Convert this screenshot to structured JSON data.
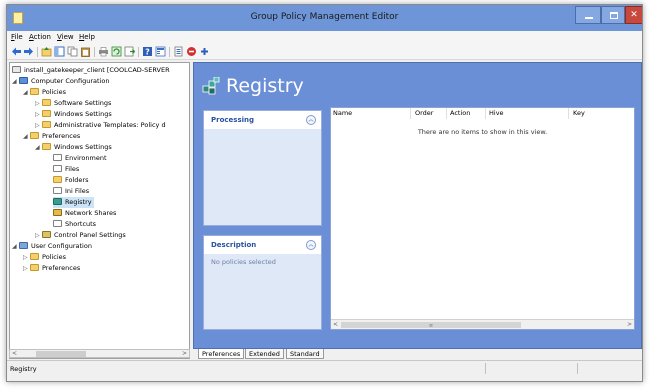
{
  "window": {
    "title": "Group Policy Management Editor"
  },
  "menu": {
    "items": [
      {
        "acc": "F",
        "rest": "ile"
      },
      {
        "acc": "A",
        "rest": "ction"
      },
      {
        "acc": "V",
        "rest": "iew"
      },
      {
        "acc": "H",
        "rest": "elp"
      }
    ]
  },
  "toolbar": {
    "icons": [
      "back-arrow-icon",
      "forward-arrow-icon",
      "up-folder-icon",
      "show-hide-tree-icon",
      "copy-icon",
      "paste-icon",
      "print-icon",
      "refresh-icon",
      "export-list-icon",
      "help-icon",
      "tree-view-icon",
      "properties-icon",
      "block-icon",
      "add-icon"
    ]
  },
  "tree": {
    "root": "install_gatekeeper_client [COOLCAD-SERVER",
    "computer_configuration": "Computer Configuration",
    "policies": "Policies",
    "software_settings": "Software Settings",
    "windows_settings": "Windows Settings",
    "admin_templates": "Administrative Templates: Policy d",
    "preferences": "Preferences",
    "pref_windows_settings": "Windows Settings",
    "environment": "Environment",
    "files": "Files",
    "folders": "Folders",
    "ini_files": "Ini Files",
    "registry": "Registry",
    "network_shares": "Network Shares",
    "shortcuts": "Shortcuts",
    "control_panel_settings": "Control Panel Settings",
    "user_configuration": "User Configuration",
    "user_policies": "Policies",
    "user_preferences": "Preferences"
  },
  "main": {
    "heading": "Registry",
    "processing": {
      "title": "Processing"
    },
    "description": {
      "title": "Description",
      "text": "No policies selected"
    },
    "list": {
      "columns": [
        "Name",
        "Order",
        "Action",
        "Hive",
        "Key"
      ],
      "empty_message": "There are no items to show in this view."
    }
  },
  "tabs": [
    "Preferences",
    "Extended",
    "Standard"
  ],
  "status": {
    "text": "Registry"
  },
  "colors": {
    "title_bar": "#6e95d8",
    "content_bg": "#6b8fd6",
    "card_title": "#2a52a0"
  }
}
